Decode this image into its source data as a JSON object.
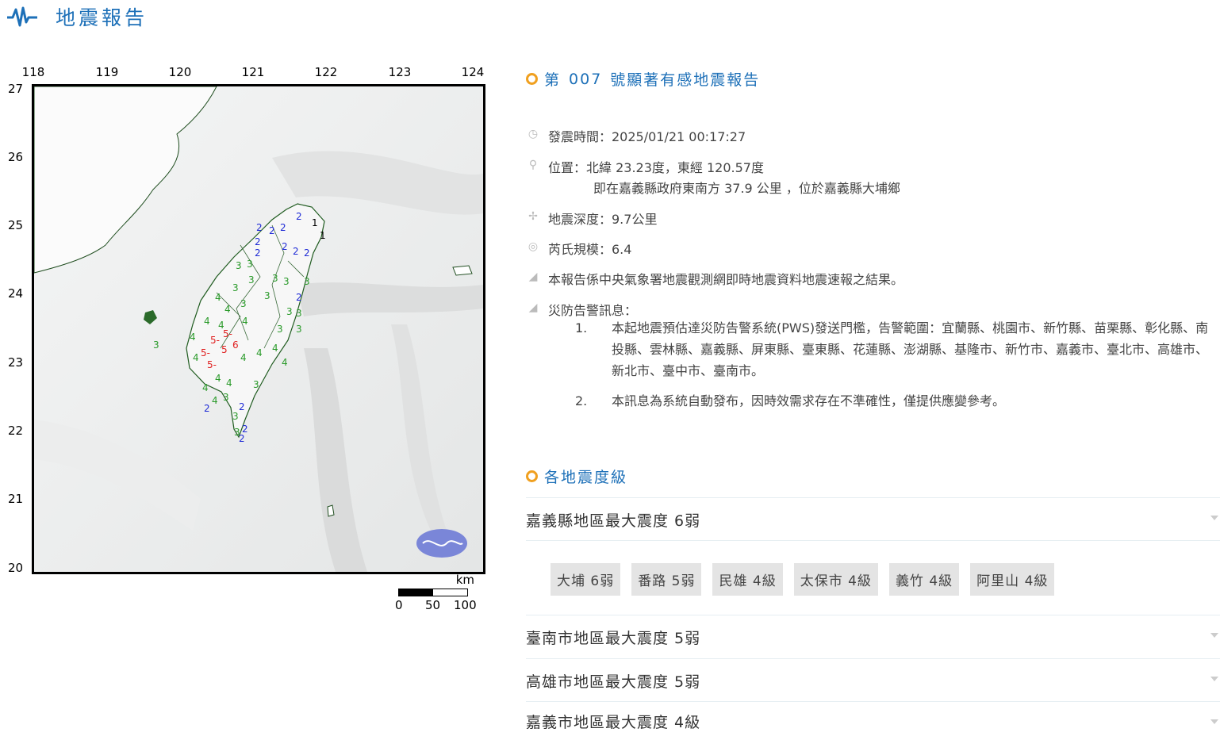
{
  "app": {
    "title": "地震報告"
  },
  "map": {
    "lon_ticks": [
      "118",
      "119",
      "120",
      "121",
      "122",
      "123",
      "124"
    ],
    "lat_ticks": [
      "27",
      "26",
      "25",
      "24",
      "23",
      "22",
      "21",
      "20"
    ],
    "scale": {
      "unit": "km",
      "labels": [
        "0",
        "50",
        "100"
      ]
    },
    "intensity_colors": {
      "2": "#1f2bd6",
      "3": "#2a9a2a",
      "4": "#2a9a2a",
      "5": "#e02020",
      "1": "#000000"
    }
  },
  "report": {
    "title_prefix": "第",
    "number": "007",
    "title_suffix": "號顯著有感地震報告",
    "time": "發震時間：2025/01/21 00:17:27",
    "location": "位置：北緯 23.23度，東經 120.57度",
    "location_desc": "即在嘉義縣政府東南方 37.9 公里 ，位於嘉義縣大埔鄉",
    "depth": "地震深度：9.7公里",
    "magnitude": "芮氏規模：6.4",
    "source_note": "本報告係中央氣象署地震觀測網即時地震資料地震速報之結果。",
    "alert_title": "災防告警訊息：",
    "alerts": [
      {
        "num": "1.",
        "text": "本起地震預估達災防告警系統(PWS)發送門檻，告警範圍：宜蘭縣、桃園市、新竹縣、苗栗縣、彰化縣、南投縣、雲林縣、嘉義縣、屏東縣、臺東縣、花蓮縣、澎湖縣、基隆市、新竹市、嘉義市、臺北市、高雄市、新北市、臺中市、臺南市。"
      },
      {
        "num": "2.",
        "text": "本訊息為系統自動發布，因時效需求存在不準確性，僅提供應變參考。"
      }
    ],
    "intensity_section": "各地震度級",
    "regions": [
      {
        "label": "嘉義縣地區最大震度 6弱"
      },
      {
        "label": "臺南市地區最大震度 5弱"
      },
      {
        "label": "高雄市地區最大震度 5弱"
      },
      {
        "label": "嘉義市地區最大震度 4級"
      }
    ],
    "stations": [
      "大埔 6弱",
      "番路 5弱",
      "民雄 4級",
      "太保市 4級",
      "義竹 4級",
      "阿里山 4級"
    ]
  }
}
